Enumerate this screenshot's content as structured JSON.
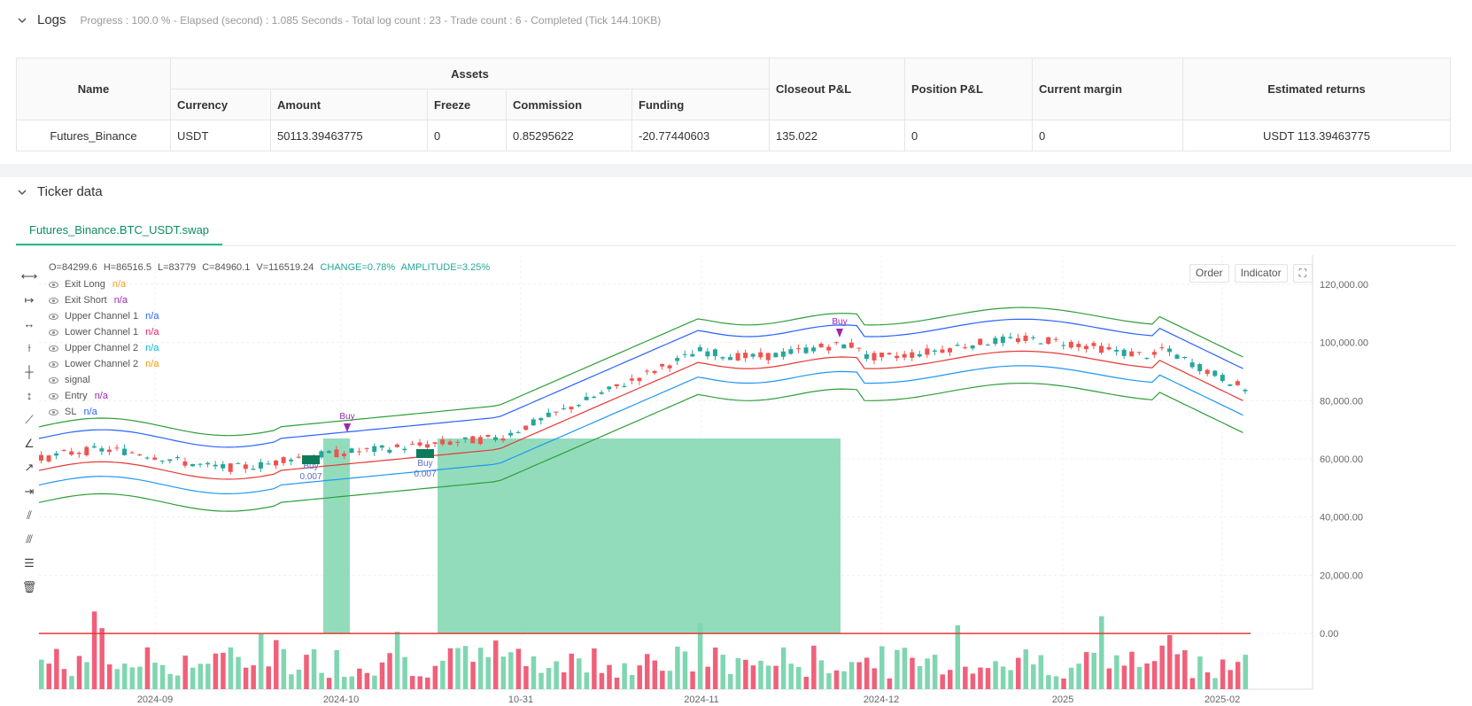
{
  "logs": {
    "title": "Logs",
    "status": "Progress : 100.0 % - Elapsed (second) : 1.085 Seconds - Total log count : 23 - Trade count : 6 - Completed (Tick 144.10KB)"
  },
  "assets_table": {
    "headers": {
      "name": "Name",
      "assets": "Assets",
      "currency": "Currency",
      "amount": "Amount",
      "freeze": "Freeze",
      "commission": "Commission",
      "funding": "Funding",
      "closeout": "Closeout P&L",
      "position": "Position P&L",
      "margin": "Current margin",
      "returns": "Estimated returns"
    },
    "row": {
      "name": "Futures_Binance",
      "currency": "USDT",
      "amount": "50113.39463775",
      "freeze": "0",
      "commission": "0.85295622",
      "funding": "-20.77440603",
      "closeout": "135.022",
      "position": "0",
      "margin": "0",
      "returns": "USDT 113.39463775"
    }
  },
  "ticker": {
    "title": "Ticker data",
    "tab": "Futures_Binance.BTC_USDT.swap",
    "buttons": {
      "order": "Order",
      "indicator": "Indicator"
    },
    "ohlc": {
      "o": "O=84299.6",
      "h": "H=86516.5",
      "l": "L=83779",
      "c": "C=84960.1",
      "v": "V=116519.24",
      "change": "CHANGE=0.78%",
      "amplitude": "AMPLITUDE=3.25%"
    },
    "legend": [
      {
        "label": "Exit Long",
        "value": "n/a",
        "color": "#f0a020"
      },
      {
        "label": "Exit Short",
        "value": "n/a",
        "color": "#9c27b0"
      },
      {
        "label": "Upper Channel 1",
        "value": "n/a",
        "color": "#2962ff"
      },
      {
        "label": "Lower Channel 1",
        "value": "n/a",
        "color": "#e91e63"
      },
      {
        "label": "Upper Channel 2",
        "value": "n/a",
        "color": "#00bcd4"
      },
      {
        "label": "Lower Channel 2",
        "value": "n/a",
        "color": "#ff9800"
      },
      {
        "label": "signal",
        "value": "",
        "color": "#888888"
      },
      {
        "label": "Entry",
        "value": "n/a",
        "color": "#9c27b0"
      },
      {
        "label": "SL",
        "value": "n/a",
        "color": "#2962ff"
      }
    ]
  },
  "chart_data": {
    "type": "candlestick",
    "y_ticks": [
      "120,000.00",
      "100,000.00",
      "80,000.00",
      "60,000.00",
      "40,000.00",
      "20,000.00",
      "0.00"
    ],
    "x_ticks": [
      "2024-09",
      "2024-10",
      "10-31",
      "2024-11",
      "2024-12",
      "2025",
      "2025-02"
    ],
    "ylim": [
      -10000,
      130000
    ],
    "annotations": [
      {
        "text": "Buy",
        "kind": "top"
      },
      {
        "text": "Buy",
        "kind": "top"
      },
      {
        "text": "Buy",
        "kind": "bottom"
      },
      {
        "text": "0.007",
        "kind": "bottom"
      },
      {
        "text": "Buy",
        "kind": "bottom"
      },
      {
        "text": "0.007",
        "kind": "bottom"
      }
    ],
    "colors": {
      "up": "#26a69a",
      "down": "#ef5350",
      "fill": "#7fd6b0"
    }
  }
}
